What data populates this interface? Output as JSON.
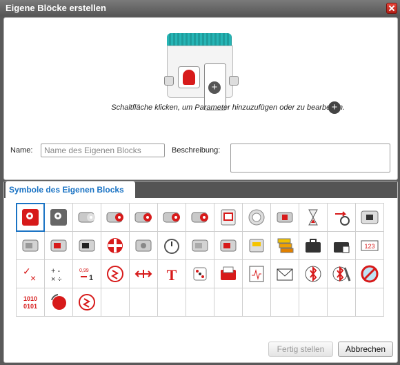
{
  "window": {
    "title": "Eigene Blöcke erstellen"
  },
  "preview": {
    "hint": "Schaltfläche klicken, um Parameter hinzuzufügen oder zu bearbeiten."
  },
  "form": {
    "name_label": "Name:",
    "name_placeholder": "Name des Eigenen Blocks",
    "description_label": "Beschreibung:"
  },
  "symbols": {
    "tab_label": "Symbole des Eigenen Blocks",
    "rows": [
      [
        "head-gear-red",
        "head-gear-gray",
        "large-motor",
        "medium-motor",
        "move-steering",
        "move-tank",
        "tank-motors",
        "display",
        "sound",
        "brick-status-light",
        "timer-hourglass",
        "loop-interrupt",
        "stop-block"
      ],
      [
        "touch-sensor",
        "color-sensor",
        "infrared-sensor",
        "gyro-sensor",
        "brick-buttons",
        "stopwatch",
        "ultrasonic-sensor",
        "motor-rotation",
        "energy-meter",
        "data-stack",
        "briefcase",
        "briefcase-lock",
        "numbers-123"
      ],
      [
        "logic-operations",
        "math-operations",
        "round-operation",
        "compare-wave",
        "range-operation",
        "text-T",
        "random-dice",
        "file-access",
        "data-logging",
        "messaging-envelope",
        "bluetooth",
        "bluetooth-wrench",
        "no-wifi"
      ],
      [
        "binary-1010",
        "rotation-reset",
        "compare-wave-2",
        "empty",
        "empty",
        "empty",
        "empty",
        "empty",
        "empty",
        "empty",
        "empty",
        "empty",
        "empty"
      ]
    ],
    "binary_text_top": "1010",
    "binary_text_bottom": "0101",
    "numbers_text": "123",
    "text_letter": "T",
    "round_text_top": "0,99",
    "round_text_bottom": "1"
  },
  "buttons": {
    "finish": "Fertig stellen",
    "cancel": "Abbrechen"
  },
  "colors": {
    "accent": "#1a73c4",
    "lego_red": "#d71a1a",
    "teal": "#26b5b5"
  }
}
